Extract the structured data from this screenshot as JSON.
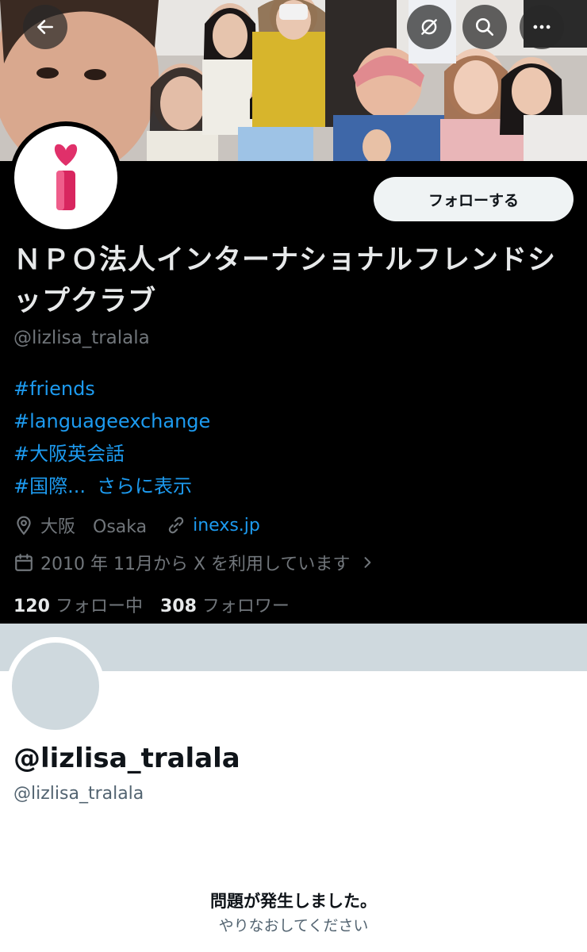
{
  "header": {
    "back_icon": "arrow-left-icon",
    "refresh_icon": "refresh-icon",
    "search_icon": "search-icon",
    "more_icon": "more-dots-icon"
  },
  "profile": {
    "avatar_logo": "heart-i-logo",
    "follow_label": "フォローする",
    "display_name": "ＮＰＯ法人インターナショナルフレンドシップクラブ",
    "handle": "@lizlisa_tralala",
    "bio": {
      "tag1": "#friends",
      "tag2": "#languageexchange",
      "tag3": "#大阪英会話",
      "tag4": "#国際...",
      "show_more": "さらに表示"
    },
    "location": "大阪　Osaka",
    "url": "inexs.jp",
    "joined": "2010 年 11月から X を利用しています",
    "following_count": "120",
    "following_label": "フォロー中",
    "followers_count": "308",
    "followers_label": "フォロワー"
  },
  "second_profile": {
    "name": "@lizlisa_tralala",
    "handle": "@lizlisa_tralala"
  },
  "error": {
    "title": "問題が発生しました。",
    "subtitle": "やりなおしてください"
  },
  "colors": {
    "accent_link": "#1d9bf0",
    "dark_bg": "#000000",
    "muted": "#71767b",
    "logo_pink": "#e0306a"
  }
}
